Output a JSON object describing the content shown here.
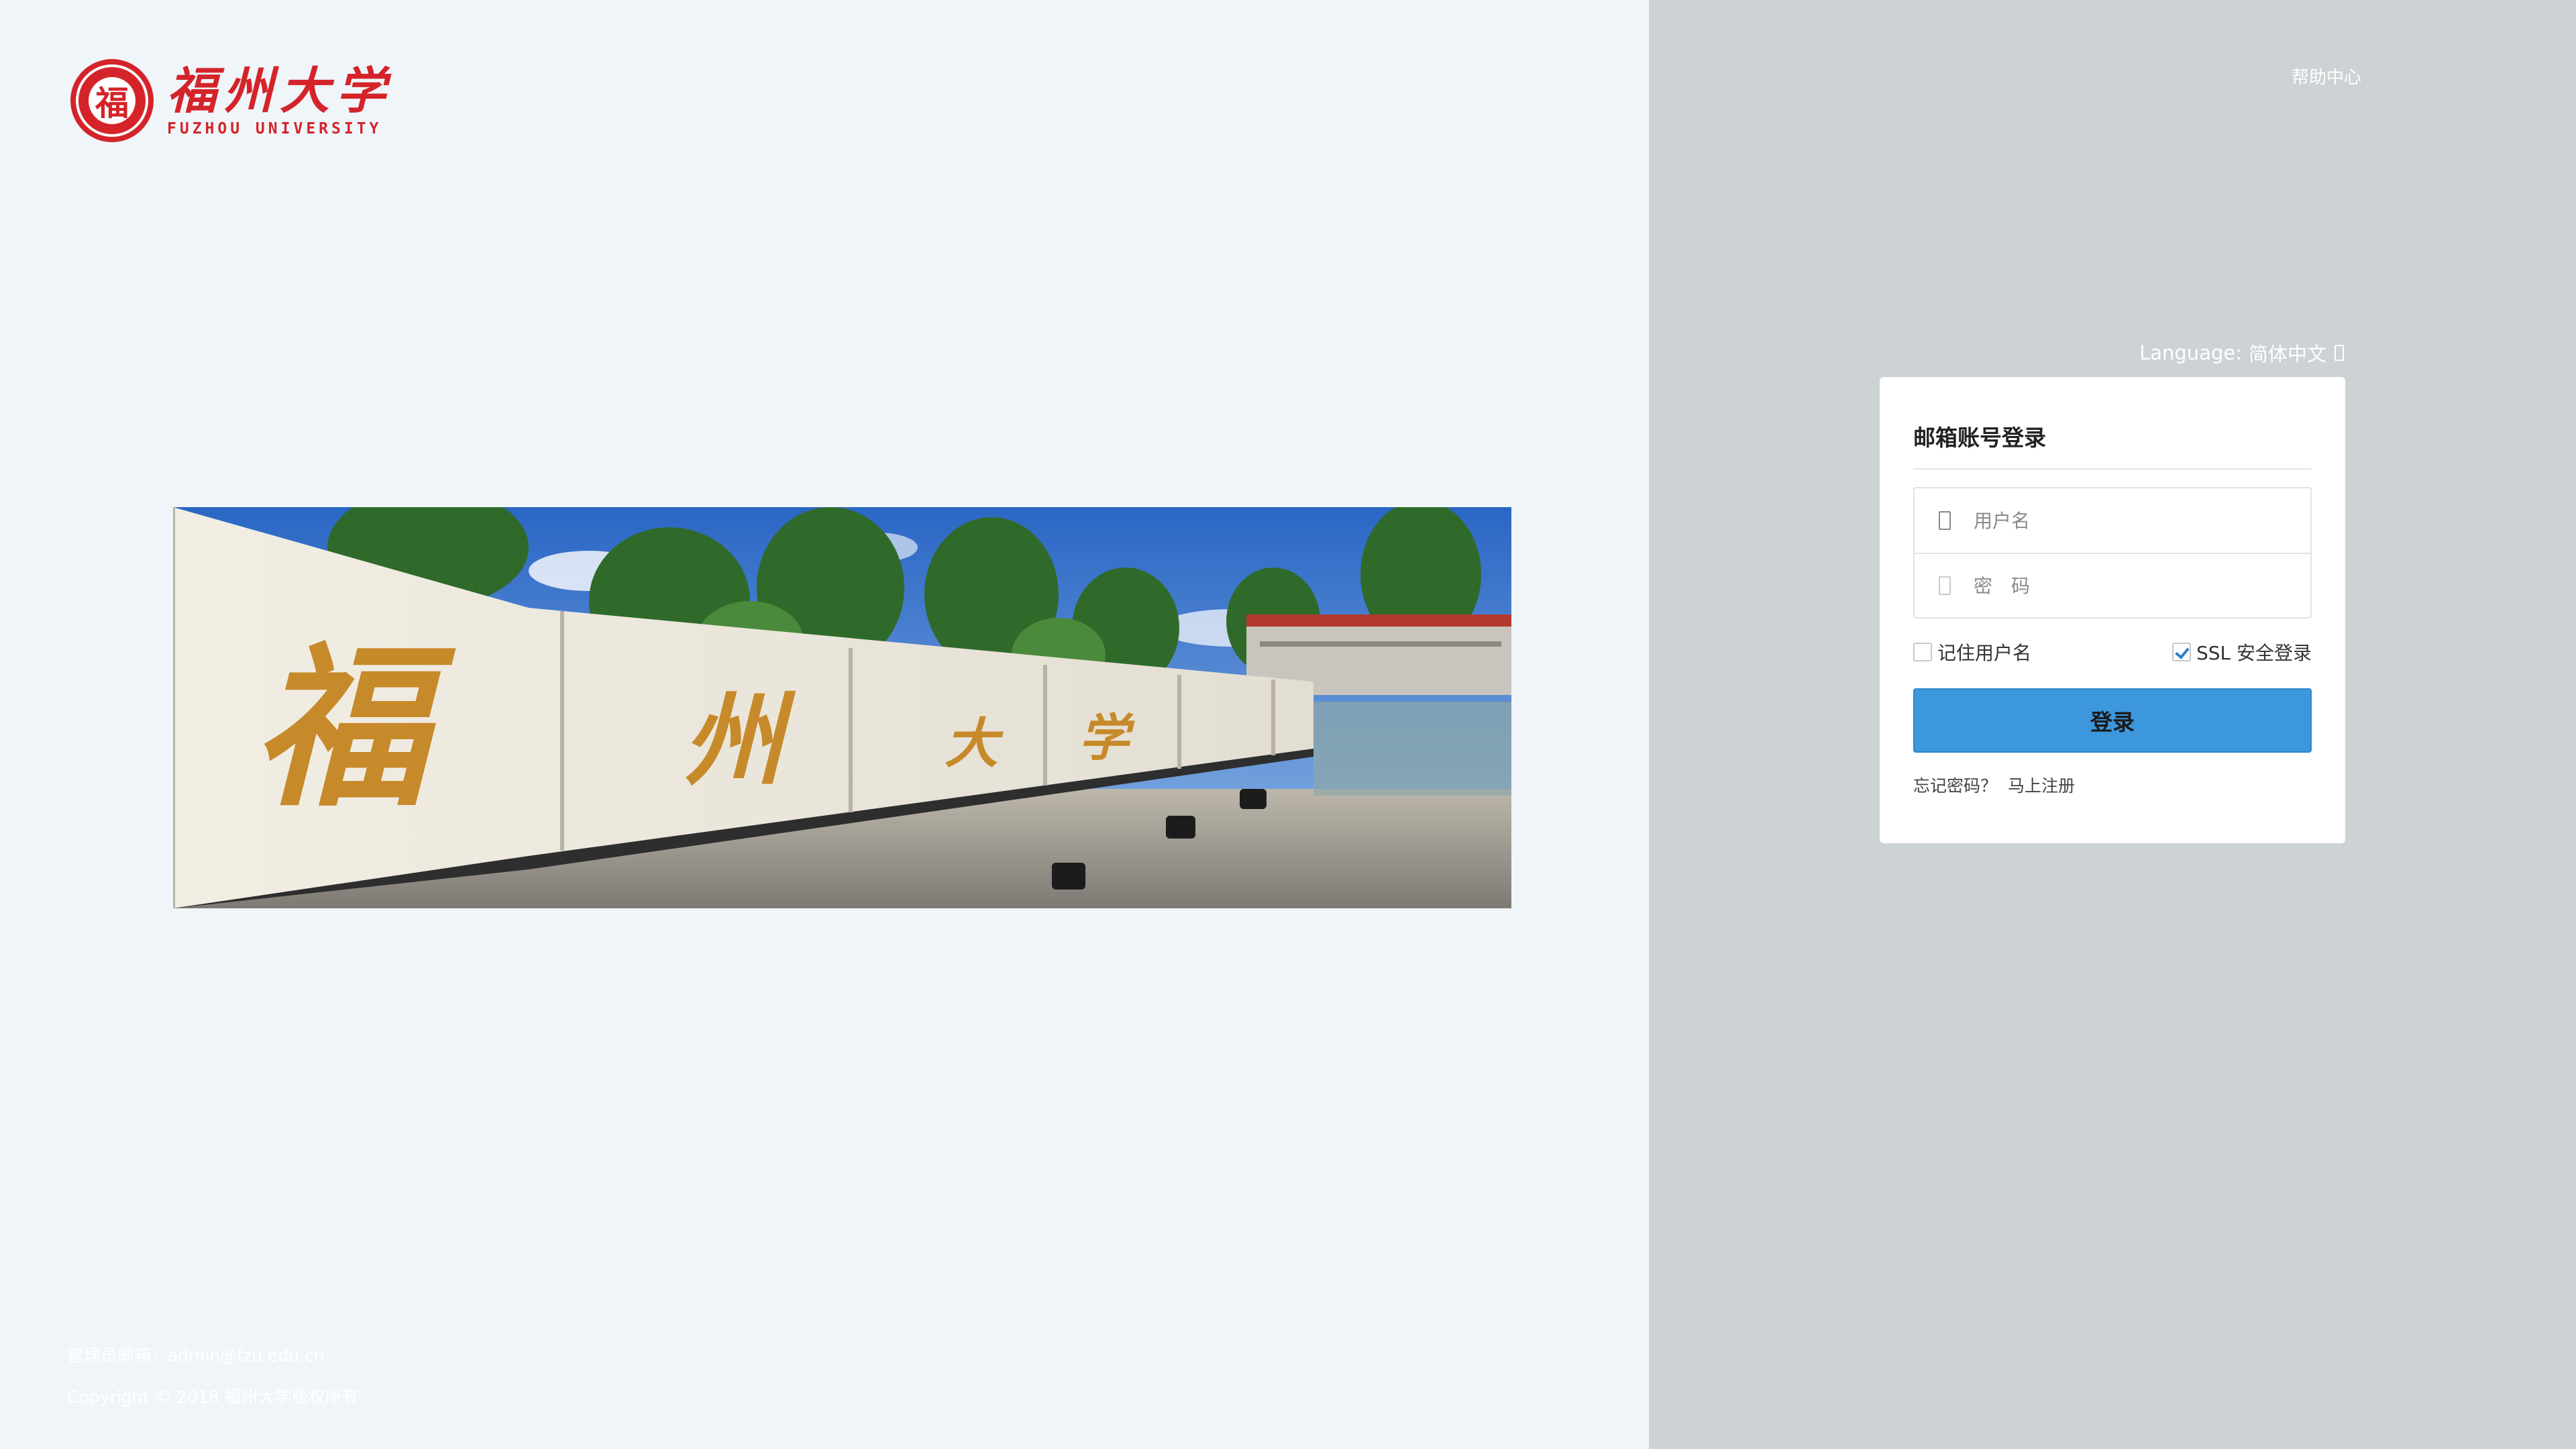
{
  "logo": {
    "seal_char": "福",
    "name_cn": "福州大学",
    "name_en": "FUZHOU UNIVERSITY"
  },
  "banner": {
    "wall_chars": [
      "福",
      "州",
      "大",
      "学"
    ]
  },
  "footer": {
    "contact": "管理员邮箱：admin@fzu.edu.cn",
    "copyright": "Copyright © 2018 福州大学版权所有"
  },
  "header": {
    "help_label": "帮助中心"
  },
  "language": {
    "label": "Language:",
    "value": "简体中文",
    "icon": "caret-down-icon"
  },
  "login": {
    "title": "邮箱账号登录",
    "username_placeholder": "用户名",
    "password_placeholder": "密　码",
    "username_icon": "user-icon",
    "password_icon": "lock-icon",
    "remember_label": "记住用户名",
    "remember_checked": false,
    "ssl_label": "SSL 安全登录",
    "ssl_checked": true,
    "submit_label": "登录",
    "forgot_label": "忘记密码？",
    "register_label": "马上注册"
  },
  "colors": {
    "left_bg": "#f0f5f9",
    "right_bg": "#cdd2d5",
    "brand_red": "#d4242a",
    "button_blue": "#3d97dc"
  }
}
